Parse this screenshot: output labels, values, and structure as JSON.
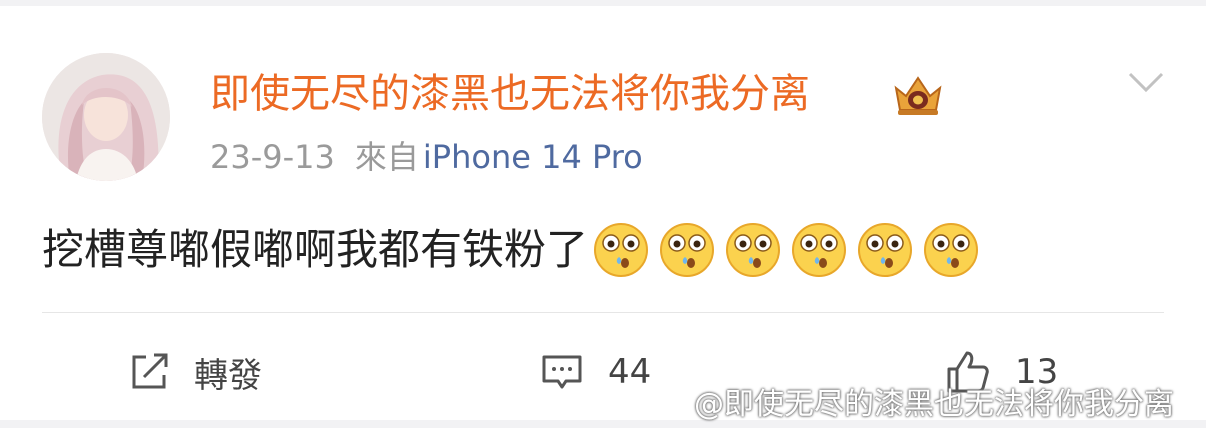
{
  "post": {
    "username": "即使无尽的漆黑也无法将你我分离",
    "date": "23-9-13",
    "from_label": "來自",
    "device": "iPhone 14 Pro",
    "content": "挖槽尊嘟假嘟啊我都有铁粉了",
    "emojis": [
      "shocked-emoji",
      "shocked-emoji",
      "shocked-emoji",
      "shocked-emoji",
      "shocked-emoji",
      "shocked-emoji"
    ]
  },
  "actions": {
    "repost_label": "轉發",
    "comment_count": "44",
    "like_count": "13"
  },
  "watermark": {
    "text": "@即使无尽的漆黑也无法将你我分离"
  },
  "colors": {
    "username": "#ec6a24",
    "device": "#4f6aa0",
    "meta": "#9a9a9a",
    "content": "#222222"
  },
  "icons": [
    "vip-crown-icon",
    "chevron-down-icon",
    "repost-icon",
    "comment-icon",
    "like-icon",
    "weibo-logo-icon"
  ]
}
